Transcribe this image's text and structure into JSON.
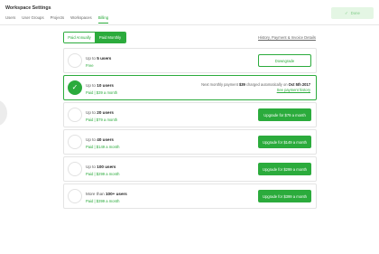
{
  "header": {
    "title": "Workspace Settings",
    "done_label": "Done",
    "tabs": [
      {
        "label": "Users"
      },
      {
        "label": "User Groups"
      },
      {
        "label": "Projects"
      },
      {
        "label": "Workspaces"
      },
      {
        "label": "Billing"
      }
    ],
    "active_tab": "Billing"
  },
  "billing": {
    "toggle": {
      "annual": "Paid Annually",
      "monthly": "Paid Monthly",
      "selected": "monthly"
    },
    "history_link": "History, Payment & Invoice Details",
    "plans": [
      {
        "name_prefix": "Up to",
        "name_bold": "5 users",
        "price": "Free",
        "action": "Downgrade",
        "action_style": "outline"
      },
      {
        "name_prefix": "Up to",
        "name_bold": "10 users",
        "price": "Paid | $39 a month",
        "current": true,
        "note_pre": "Next monthly payment",
        "note_amount": "$39",
        "note_mid": "charged automatically on",
        "note_date": "Oct 5th 2017",
        "note_link": "See payment history"
      },
      {
        "name_prefix": "Up to",
        "name_bold": "20 users",
        "price": "Paid | $79 a month",
        "action": "Upgrade for $79 a month",
        "action_style": "solid"
      },
      {
        "name_prefix": "Up to",
        "name_bold": "40 users",
        "price": "Paid | $149 a month",
        "action": "Upgrade for $149 a month",
        "action_style": "solid"
      },
      {
        "name_prefix": "Up to",
        "name_bold": "100 users",
        "price": "Paid | $299 a month",
        "action": "Upgrade for $299 a month",
        "action_style": "solid"
      },
      {
        "name_prefix": "More than",
        "name_bold": "100+ users",
        "price": "Paid | $399 a month",
        "action": "Upgrade for $399 a month",
        "action_style": "solid"
      }
    ]
  },
  "colors": {
    "accent": "#2bab3c",
    "border": "#e4e4e4"
  }
}
